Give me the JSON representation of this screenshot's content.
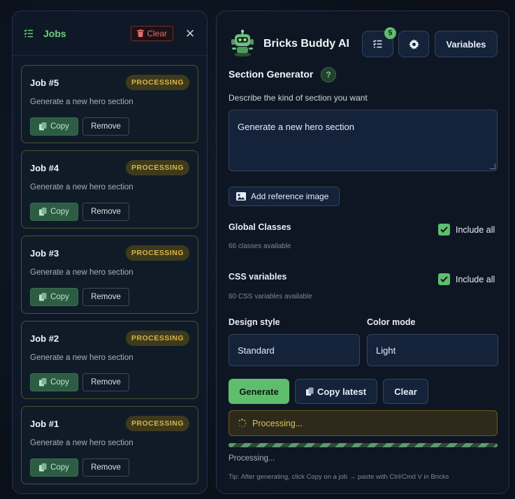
{
  "jobs_panel": {
    "title": "Jobs",
    "clear_label": "Clear",
    "close_glyph": "×",
    "jobs": [
      {
        "title": "Job #5",
        "status": "PROCESSING",
        "description": "Generate a new hero section",
        "copy_label": "Copy",
        "remove_label": "Remove"
      },
      {
        "title": "Job #4",
        "status": "PROCESSING",
        "description": "Generate a new hero section",
        "copy_label": "Copy",
        "remove_label": "Remove"
      },
      {
        "title": "Job #3",
        "status": "PROCESSING",
        "description": "Generate a new hero section",
        "copy_label": "Copy",
        "remove_label": "Remove"
      },
      {
        "title": "Job #2",
        "status": "PROCESSING",
        "description": "Generate a new hero section",
        "copy_label": "Copy",
        "remove_label": "Remove"
      },
      {
        "title": "Job #1",
        "status": "PROCESSING",
        "description": "Generate a new hero section",
        "copy_label": "Copy",
        "remove_label": "Remove"
      }
    ]
  },
  "main": {
    "app_title": "Bricks Buddy AI",
    "jobs_count": "5",
    "variables_label": "Variables",
    "section_title": "Section Generator",
    "help_glyph": "?",
    "describe_label": "Describe the kind of section you want",
    "prompt_value": "Generate a new hero section",
    "reference_image_label": "Add reference image",
    "global_classes": {
      "label": "Global Classes",
      "sub": "66 classes available",
      "include_label": "Include all",
      "checked": true
    },
    "css_variables": {
      "label": "CSS variables",
      "sub": "60 CSS variables available",
      "include_label": "Include all",
      "checked": true
    },
    "design_style": {
      "label": "Design style",
      "value": "Standard"
    },
    "color_mode": {
      "label": "Color mode",
      "value": "Light"
    },
    "generate_label": "Generate",
    "copy_latest_label": "Copy latest",
    "clear_label": "Clear",
    "status_text": "Processing...",
    "progress_text": "Processing...",
    "tip": "Tip: After generating, click Copy on a job → paste with Ctrl/Cmd V in Bricks"
  },
  "colors": {
    "accent": "#5fbd6e",
    "processing": "#d8b44a",
    "danger": "#e46b6b",
    "panel": "#0f1826"
  },
  "icons": [
    "list-check-icon",
    "trash-icon",
    "close-icon",
    "copy-icon",
    "robot-logo-icon",
    "gear-icon",
    "image-icon",
    "check-icon",
    "spinner-icon"
  ]
}
